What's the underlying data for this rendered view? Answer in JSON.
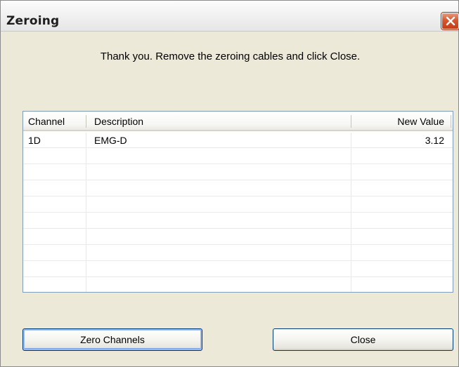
{
  "window": {
    "title": "Zeroing"
  },
  "message": "Thank you. Remove the zeroing cables and click Close.",
  "table": {
    "columns": [
      "Channel",
      "Description",
      "New Value"
    ],
    "rows": [
      {
        "channel": "1D",
        "description": "EMG-D",
        "new_value": "3.12"
      }
    ]
  },
  "buttons": {
    "zero_channels": "Zero Channels",
    "close": "Close"
  },
  "icons": {
    "close": "close-icon"
  },
  "colors": {
    "close_button": "#d9552f",
    "dialog_background": "#ece9d8",
    "list_border": "#7f9db9"
  }
}
